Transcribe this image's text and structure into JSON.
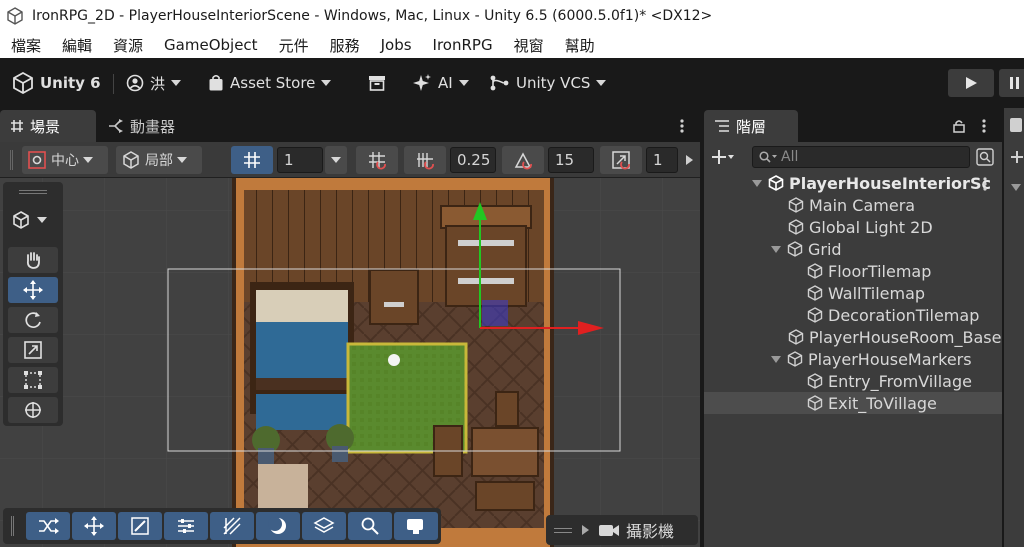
{
  "window": {
    "title": "IronRPG_2D - PlayerHouseInteriorScene - Windows, Mac, Linux - Unity 6.5 (6000.5.0f1)* <DX12>"
  },
  "menu": [
    "檔案",
    "編輯",
    "資源",
    "GameObject",
    "元件",
    "服務",
    "Jobs",
    "IronRPG",
    "視窗",
    "幫助"
  ],
  "toolbar": {
    "unity_label": "Unity 6",
    "account_label": "洪",
    "asset_store_label": "Asset Store",
    "ai_label": "AI",
    "vcs_label": "Unity VCS"
  },
  "scene_tabs": {
    "scene": "場景",
    "animator": "動畫器"
  },
  "scene_toolbar": {
    "pivot_label": "中心",
    "space_label": "局部",
    "grid_value": "1",
    "snap_move_value": "0.25",
    "snap_rotate_value": "15",
    "snap_scale_value": "1"
  },
  "overlay": {
    "camera_label": "攝影機"
  },
  "hierarchy": {
    "tab_label": "階層",
    "search_placeholder": "All",
    "items": [
      {
        "label": "PlayerHouseInteriorSc",
        "depth": 0,
        "expanded": true,
        "root": true
      },
      {
        "label": "Main Camera",
        "depth": 1
      },
      {
        "label": "Global Light 2D",
        "depth": 1
      },
      {
        "label": "Grid",
        "depth": 1,
        "expanded": true
      },
      {
        "label": "FloorTilemap",
        "depth": 2
      },
      {
        "label": "WallTilemap",
        "depth": 2
      },
      {
        "label": "DecorationTilemap",
        "depth": 2
      },
      {
        "label": "PlayerHouseRoom_Base",
        "depth": 1
      },
      {
        "label": "PlayerHouseMarkers",
        "depth": 1,
        "expanded": true
      },
      {
        "label": "Entry_FromVillage",
        "depth": 2
      },
      {
        "label": "Exit_ToVillage",
        "depth": 2,
        "selected": true
      }
    ]
  },
  "colors": {
    "selection_blue": "#3e5f87",
    "gizmo_y": "#22c722",
    "gizmo_x": "#e02020"
  }
}
